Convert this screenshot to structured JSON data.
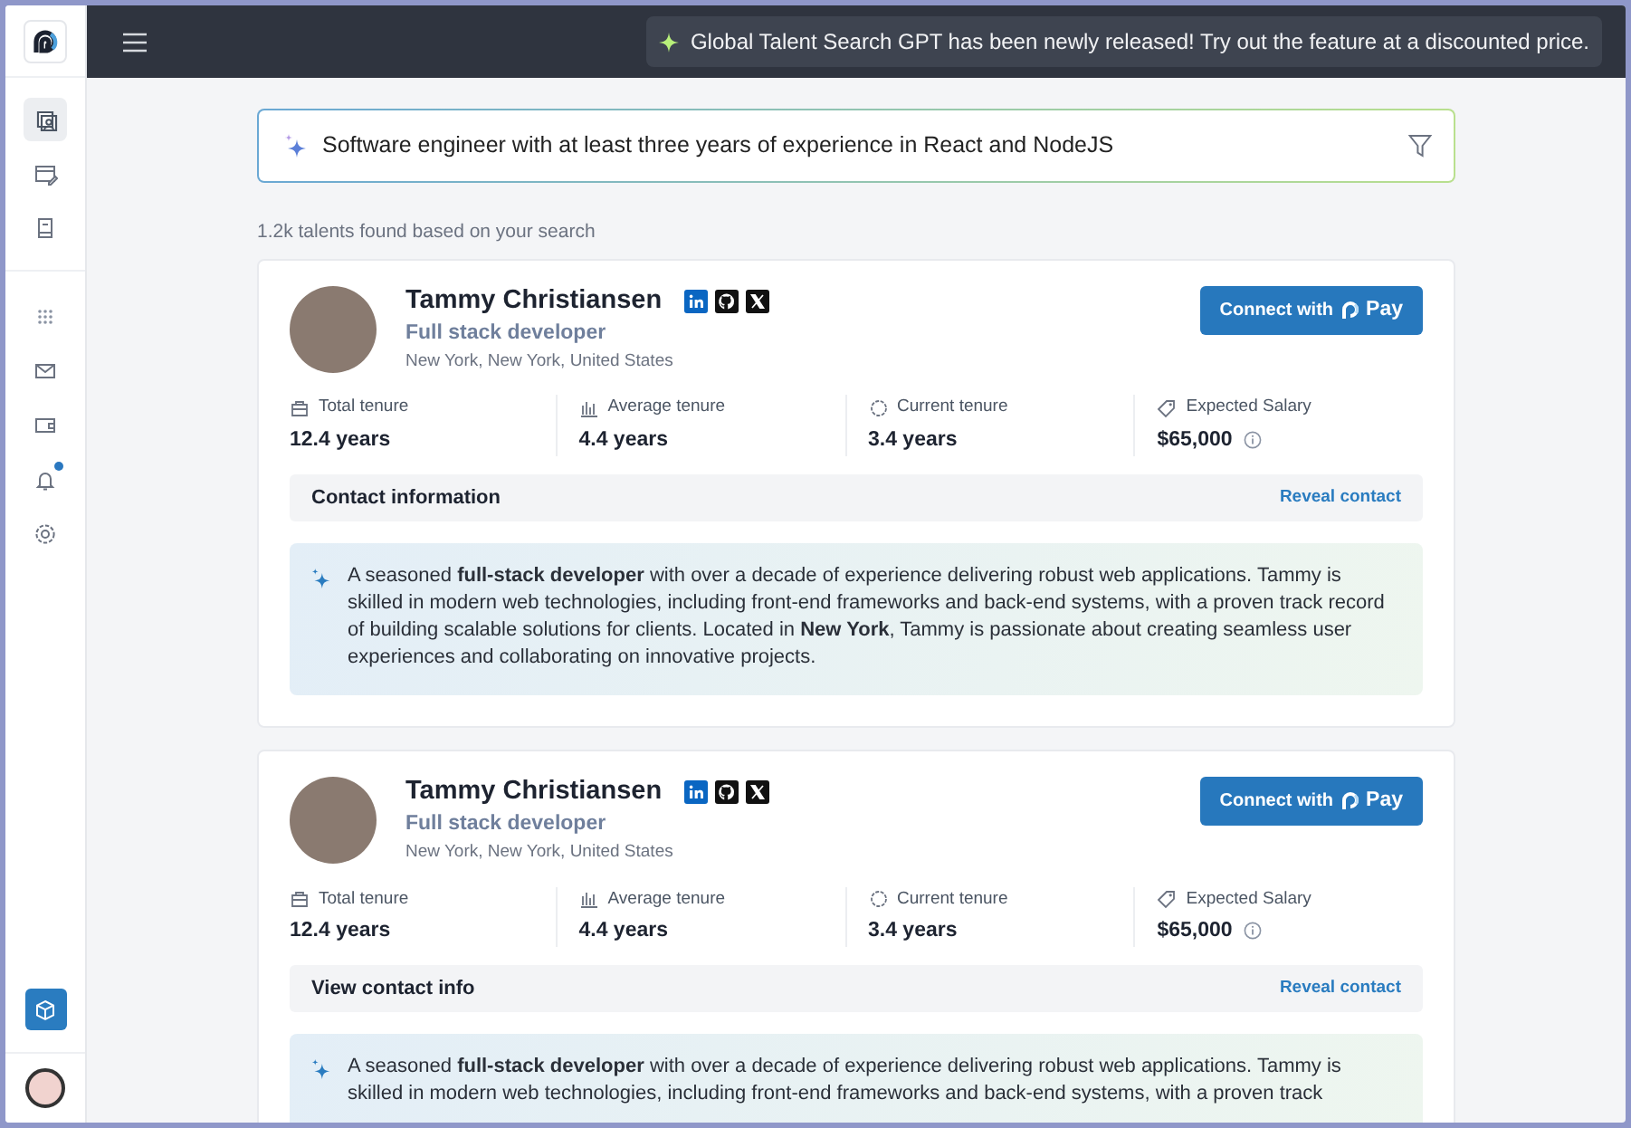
{
  "sidebar": {
    "top_items": [
      {
        "selected": true,
        "dot": false
      },
      {
        "selected": false,
        "dot": false
      },
      {
        "selected": false,
        "dot": false
      }
    ],
    "middle_items": [
      {
        "selected": false,
        "dot": false
      },
      {
        "selected": false,
        "dot": false
      },
      {
        "selected": false,
        "dot": false
      },
      {
        "selected": false,
        "dot": true
      },
      {
        "selected": false,
        "dot": false
      }
    ]
  },
  "topbar": {
    "announcement": "Global Talent Search GPT has been newly released! Try out the feature at a discounted price."
  },
  "search": {
    "value": "Software engineer with at least three years of experience in React and NodeJS"
  },
  "results_count": "1.2k talents found based on your search",
  "candidates": [
    {
      "name": "Tammy Christiansen",
      "role": "Full stack developer",
      "location": "New York, New York, United States",
      "connect_button": {
        "label": "Connect with",
        "brand": "Pay"
      },
      "stats": [
        {
          "label": "Total tenure",
          "value": "12.4 years"
        },
        {
          "label": "Average tenure",
          "value": "4.4 years"
        },
        {
          "label": "Current tenure",
          "value": "3.4 years"
        },
        {
          "label": "Expected Salary",
          "value": "$65,000"
        }
      ],
      "contact": {
        "title": "Contact information",
        "link": "Reveal contact"
      },
      "summary": "A seasoned **full-stack developer** with over a decade of experience delivering robust web applications. Tammy is skilled in modern web technologies, including front-end frameworks and back-end systems, with a proven track record of building scalable solutions for clients. Located in **New York**, Tammy is passionate about creating seamless user experiences and collaborating on innovative projects."
    },
    {
      "name": "Tammy Christiansen",
      "role": "Full stack developer",
      "location": "New York, New York, United States",
      "connect_button": {
        "label": "Connect with",
        "brand": "Pay"
      },
      "stats": [
        {
          "label": "Total tenure",
          "value": "12.4 years"
        },
        {
          "label": "Average tenure",
          "value": "4.4 years"
        },
        {
          "label": "Current tenure",
          "value": "3.4 years"
        },
        {
          "label": "Expected Salary",
          "value": "$65,000"
        }
      ],
      "contact": {
        "title": "View contact info",
        "link": "Reveal contact"
      },
      "summary": "A seasoned **full-stack developer** with over a decade of experience delivering robust web applications. Tammy is skilled in modern web technologies, including front-end frameworks and back-end systems, with a proven track"
    }
  ]
}
